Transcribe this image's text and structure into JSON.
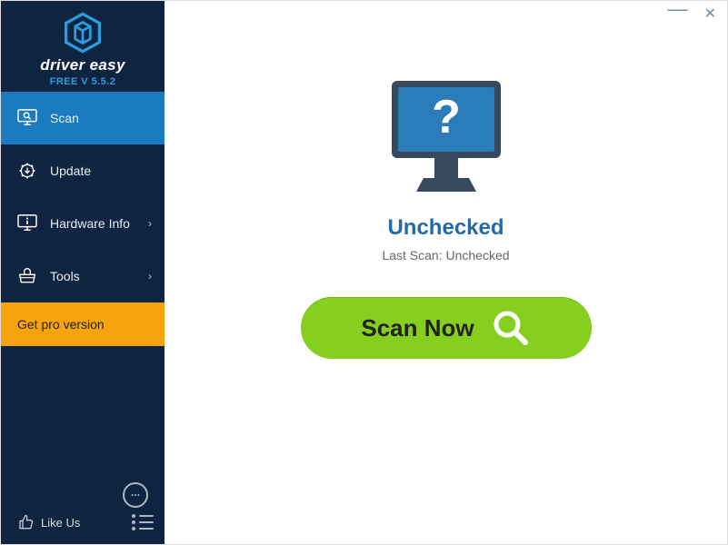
{
  "brand": {
    "name": "driver easy",
    "subtitle": "FREE V 5.5.2"
  },
  "sidebar": {
    "items": [
      {
        "label": "Scan",
        "has_chevron": false,
        "icon": "monitor-search-icon"
      },
      {
        "label": "Update",
        "has_chevron": false,
        "icon": "gear-arrow-icon"
      },
      {
        "label": "Hardware Info",
        "has_chevron": true,
        "icon": "monitor-info-icon"
      },
      {
        "label": "Tools",
        "has_chevron": true,
        "icon": "toolbox-icon"
      }
    ],
    "cta_label": "Get pro version",
    "like_label": "Like Us"
  },
  "main": {
    "status_title": "Unchecked",
    "status_sub_prefix": "Last Scan:",
    "status_sub_value": "Unchecked",
    "scan_button_label": "Scan Now",
    "monitor_question": "?"
  },
  "colors": {
    "sidebar_bg": "#0f2440",
    "active_bg": "#1b7bc0",
    "cta_bg": "#f5a40e",
    "scan_bg": "#86ce1f",
    "status_title": "#226aa8"
  }
}
